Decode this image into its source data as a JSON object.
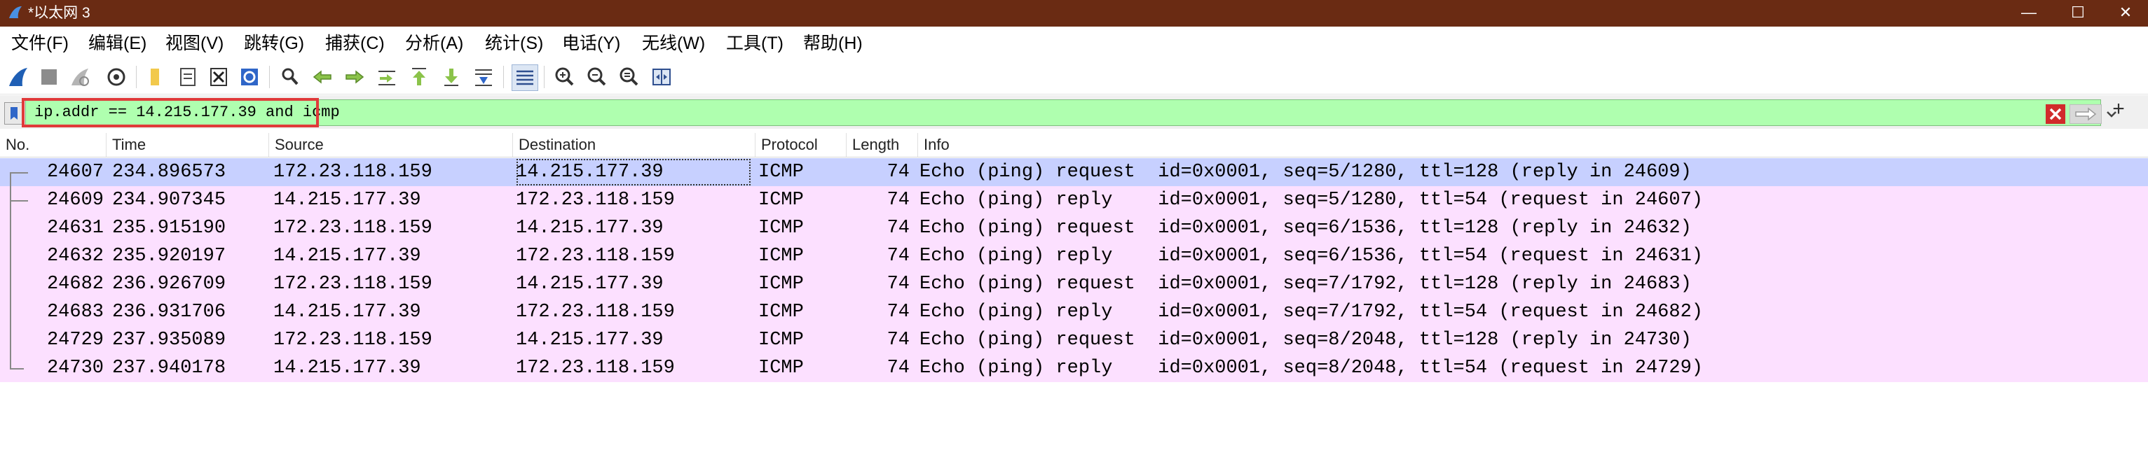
{
  "window": {
    "title": "*以太网 3",
    "minimize": "—",
    "maximize": "☐",
    "close": "✕"
  },
  "menu": [
    "文件(F)",
    "编辑(E)",
    "视图(V)",
    "跳转(G)",
    "捕获(C)",
    "分析(A)",
    "统计(S)",
    "电话(Y)",
    "无线(W)",
    "工具(T)",
    "帮助(H)"
  ],
  "toolbar": {
    "icons": [
      "shark-fin-start-icon",
      "stop-capture-icon",
      "restart-capture-icon",
      "capture-options-icon",
      "open-file-icon",
      "save-file-icon",
      "close-file-icon",
      "reload-file-icon",
      "find-packet-icon",
      "go-back-icon",
      "go-forward-icon",
      "go-to-packet-icon",
      "first-packet-icon",
      "last-packet-icon",
      "auto-scroll-icon",
      "colorize-icon",
      "zoom-in-icon",
      "zoom-out-icon",
      "normal-size-icon",
      "resize-columns-icon"
    ]
  },
  "filter": {
    "value": "ip.addr == 14.215.177.39 and icmp"
  },
  "columns": {
    "no": "No.",
    "time": "Time",
    "source": "Source",
    "destination": "Destination",
    "protocol": "Protocol",
    "length": "Length",
    "info": "Info"
  },
  "packets": [
    {
      "no": "24607",
      "time": "234.896573",
      "source": "172.23.118.159",
      "destination": "14.215.177.39",
      "protocol": "ICMP",
      "length": "74",
      "info": "Echo (ping) request  id=0x0001, seq=5/1280, ttl=128 (reply in 24609)"
    },
    {
      "no": "24609",
      "time": "234.907345",
      "source": "14.215.177.39",
      "destination": "172.23.118.159",
      "protocol": "ICMP",
      "length": "74",
      "info": "Echo (ping) reply    id=0x0001, seq=5/1280, ttl=54 (request in 24607)"
    },
    {
      "no": "24631",
      "time": "235.915190",
      "source": "172.23.118.159",
      "destination": "14.215.177.39",
      "protocol": "ICMP",
      "length": "74",
      "info": "Echo (ping) request  id=0x0001, seq=6/1536, ttl=128 (reply in 24632)"
    },
    {
      "no": "24632",
      "time": "235.920197",
      "source": "14.215.177.39",
      "destination": "172.23.118.159",
      "protocol": "ICMP",
      "length": "74",
      "info": "Echo (ping) reply    id=0x0001, seq=6/1536, ttl=54 (request in 24631)"
    },
    {
      "no": "24682",
      "time": "236.926709",
      "source": "172.23.118.159",
      "destination": "14.215.177.39",
      "protocol": "ICMP",
      "length": "74",
      "info": "Echo (ping) request  id=0x0001, seq=7/1792, ttl=128 (reply in 24683)"
    },
    {
      "no": "24683",
      "time": "236.931706",
      "source": "14.215.177.39",
      "destination": "172.23.118.159",
      "protocol": "ICMP",
      "length": "74",
      "info": "Echo (ping) reply    id=0x0001, seq=7/1792, ttl=54 (request in 24682)"
    },
    {
      "no": "24729",
      "time": "237.935089",
      "source": "172.23.118.159",
      "destination": "14.215.177.39",
      "protocol": "ICMP",
      "length": "74",
      "info": "Echo (ping) request  id=0x0001, seq=8/2048, ttl=128 (reply in 24730)"
    },
    {
      "no": "24730",
      "time": "237.940178",
      "source": "14.215.177.39",
      "destination": "172.23.118.159",
      "protocol": "ICMP",
      "length": "74",
      "info": "Echo (ping) reply    id=0x0001, seq=8/2048, ttl=54 (request in 24729)"
    }
  ],
  "colors": {
    "titlebar": "#6a2b13",
    "filter_valid": "#afffaf",
    "row_selected": "#c7d0ff",
    "row_icmp": "#fce0ff",
    "highlight_box": "#e03a3a"
  }
}
